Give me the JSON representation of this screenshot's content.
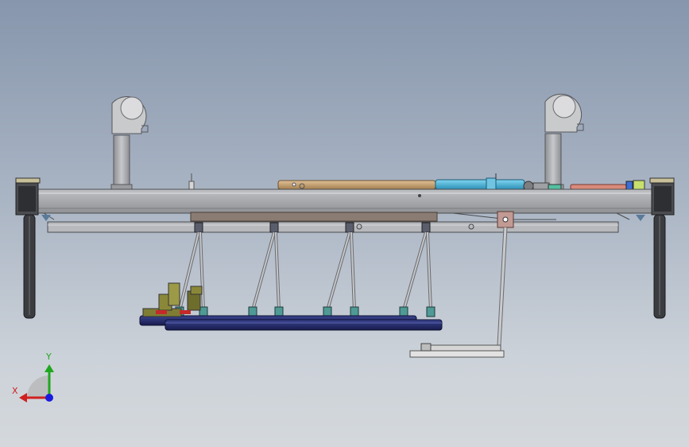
{
  "viewport": {
    "background_top": "#8796ad",
    "background_bottom": "#d4d8dc"
  },
  "triad": {
    "y_label": "Y",
    "x_label": "X",
    "y_color": "#1fa81f",
    "x_color": "#d02020",
    "z_color": "#1a1adf"
  },
  "model": {
    "colors": {
      "frame": "#a7a9ad",
      "rail": "#b7b9bd",
      "bearing": "#6e6a66",
      "panel": "#8a7c73",
      "rod_bronze": "#c6a176",
      "cylinder_cyan": "#48b4dc",
      "rod_salmon": "#d98a7a",
      "foot_navy": "#242b6a",
      "bracket_teal": "#4f9a96",
      "clamp_olive": "#7f7d34",
      "clamp_red": "#c42a2a",
      "leg_dark": "#3a3c40",
      "pivot": "#c29a94"
    }
  }
}
